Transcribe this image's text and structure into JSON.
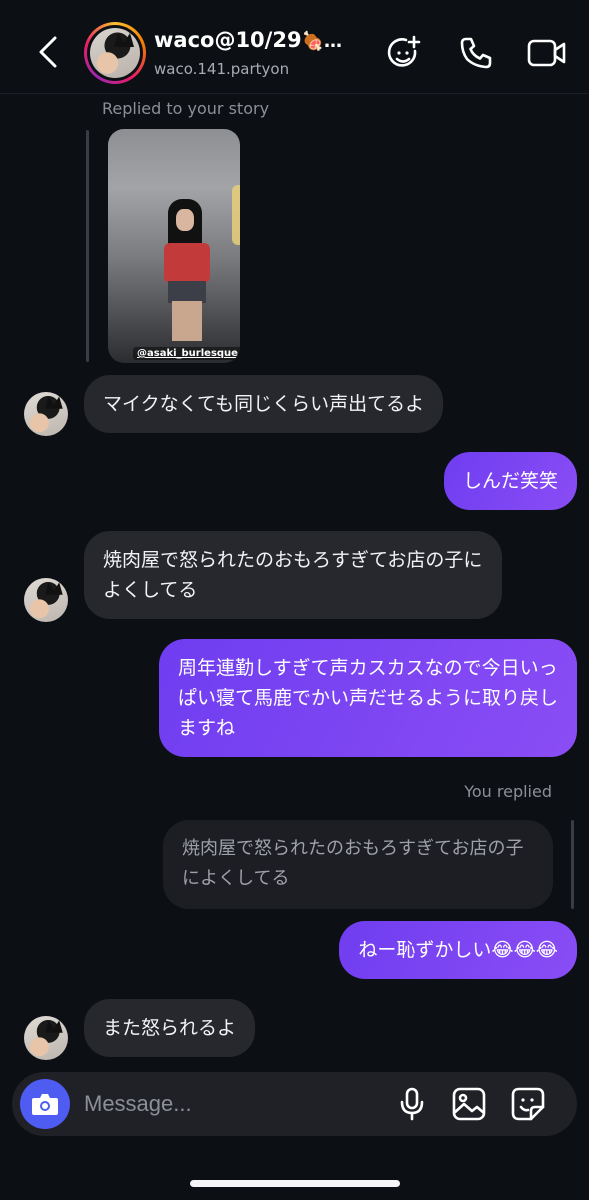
{
  "header": {
    "name": "waco@10/29",
    "name_suffix": "🍖…",
    "username": "waco.141.partyon",
    "icons": [
      "back-arrow-icon",
      "effects-icon",
      "phone-icon",
      "video-camera-icon"
    ]
  },
  "story": {
    "caption": "Replied to your story",
    "tag": "@asaki_burlesque_ts"
  },
  "messages": [
    {
      "direction": "in",
      "text": "マイクなくても同じくらい声出てるよ"
    },
    {
      "direction": "out",
      "text": "しんだ笑笑"
    },
    {
      "direction": "in",
      "text": "焼肉屋で怒られたのおもろすぎてお店の子によくしてる"
    },
    {
      "direction": "out",
      "text": "周年連勤しすぎて声カスカスなので今日いっぱい寝て馬鹿でかい声だせるように取り戻しますね"
    },
    {
      "direction": "out",
      "text": "ねー恥ずかしい😂😂😂",
      "reply_label": "You replied",
      "reply_quote": "焼肉屋で怒られたのおもろすぎてお店の子によくしてる"
    },
    {
      "direction": "in",
      "text": "また怒られるよ"
    }
  ],
  "composer": {
    "placeholder": "Message...",
    "icons": [
      "camera-icon",
      "microphone-icon",
      "gallery-icon",
      "sticker-icon"
    ],
    "accent": "#4f5cf2"
  },
  "colors": {
    "background": "#0c0f14",
    "incoming_bubble": "#26282e",
    "outgoing_bubble": "#7a45f3"
  }
}
